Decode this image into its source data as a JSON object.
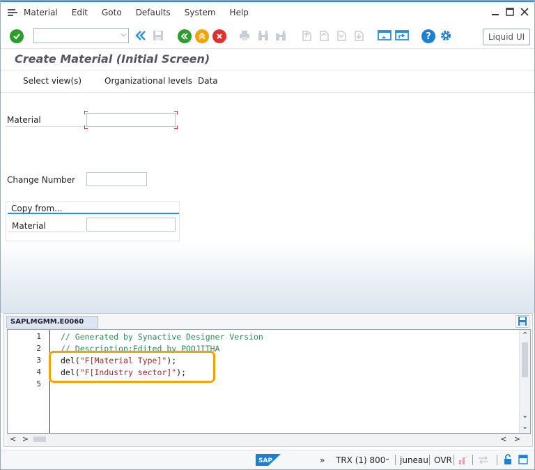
{
  "menu": {
    "items": [
      "Material",
      "Edit",
      "Goto",
      "Defaults",
      "System",
      "Help"
    ]
  },
  "toolbar": {
    "command_value": "",
    "liquid_label": "Liquid UI"
  },
  "title": "Create Material (Initial Screen)",
  "app_toolbar": {
    "select_views": "Select view(s)",
    "org_levels": "Organizational levels",
    "data": "Data"
  },
  "form": {
    "material_label": "Material",
    "material_value": "",
    "change_number_label": "Change Number",
    "change_number_value": "",
    "copy_from": {
      "title": "Copy from...",
      "material_label": "Material",
      "material_value": ""
    }
  },
  "editor": {
    "tab_label": "SAPLMGMM.E0060",
    "line_numbers": [
      "1",
      "2",
      "3",
      "4",
      "5"
    ],
    "lines": {
      "l1": "// Generated by Synactive Designer Version",
      "l2": "// Description:Edited by POOJITHA",
      "l3_prefix": "del(",
      "l3_str": "\"F[Material Type]\"",
      "l3_suffix": ");",
      "l4_prefix": "del(",
      "l4_str": "\"F[Industry sector]\"",
      "l4_suffix": ");"
    }
  },
  "status": {
    "chevrons": "»",
    "system": "TRX (1) 800",
    "user": "juneau",
    "mode": "OVR"
  },
  "colors": {
    "accent": "#2a8fd6",
    "highlight": "#f0a30a",
    "ok_green": "#2a9d2a",
    "cancel_red": "#e03030"
  }
}
